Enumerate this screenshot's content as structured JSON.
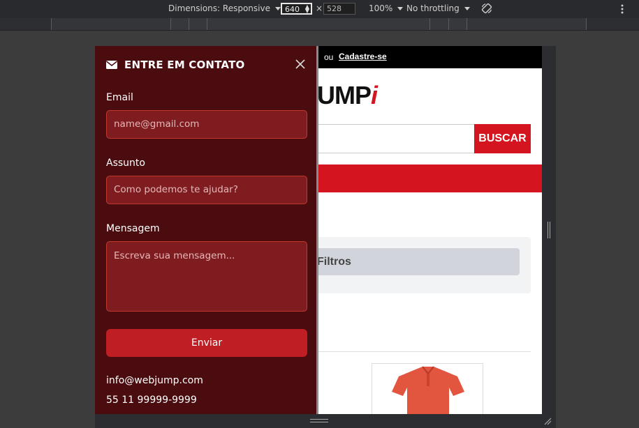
{
  "devtools": {
    "dimensions_label": "Dimensions: Responsive",
    "width_value": "640",
    "separator": "×",
    "height_value": "528",
    "zoom": "100%",
    "throttling": "No throttling"
  },
  "page": {
    "topbar": {
      "or_text": "ou",
      "signup_link": "Cadastre-se"
    },
    "logo_text": "UMP",
    "logo_accent": "i",
    "search_button": "BUSCAR",
    "filter_button": "Filtros",
    "colors": {
      "brand_red": "#d4141f",
      "drawer_bg": "#4a0c0e",
      "field_bg": "#7e1c1f",
      "send_btn": "#be1e24"
    }
  },
  "contact_drawer": {
    "title": "ENTRE EM CONTATO",
    "title_icon": "envelope-icon",
    "close_icon": "close-icon",
    "email": {
      "label": "Email",
      "placeholder": "name@gmail.com"
    },
    "subject": {
      "label": "Assunto",
      "placeholder": "Como podemos te ajudar?"
    },
    "message": {
      "label": "Mensagem",
      "placeholder": "Escreva sua mensagem..."
    },
    "send_label": "Enviar",
    "contact_email": "info@webjump.com",
    "contact_phone": "55 11 99999-9999"
  }
}
